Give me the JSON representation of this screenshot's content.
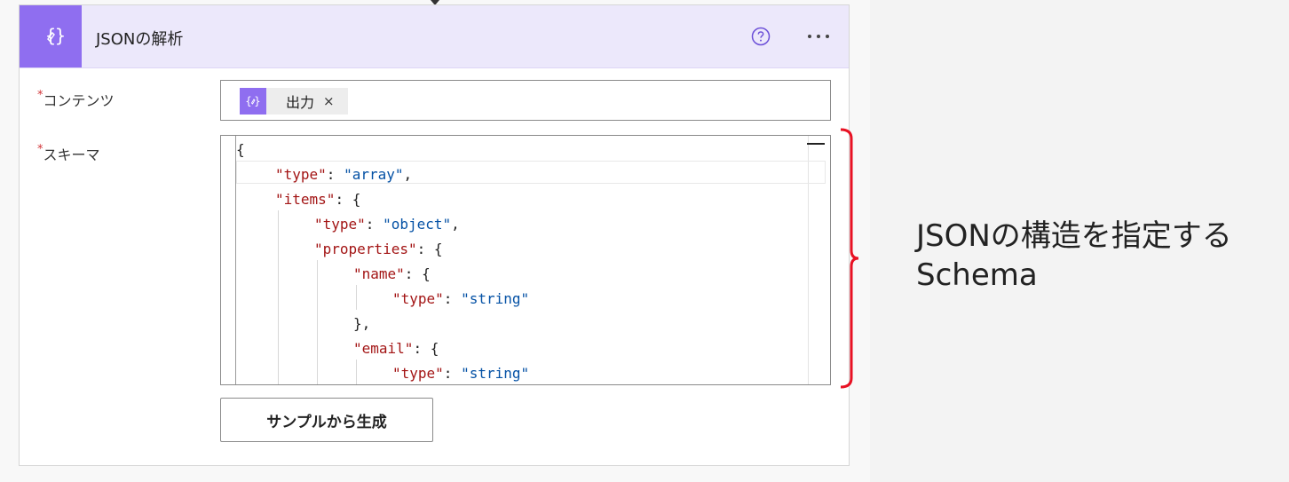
{
  "card": {
    "title": "JSONの解析",
    "help_icon": "help-circle-icon",
    "more_icon": "more-horizontal-icon",
    "action_icon": "curly-brace-expression-icon"
  },
  "fields": {
    "content": {
      "required_mark": "*",
      "label": "コンテンツ",
      "token": {
        "label": "出力",
        "close": "×",
        "icon": "curly-brace-expression-icon"
      }
    },
    "schema": {
      "required_mark": "*",
      "label": "スキーマ",
      "lines": [
        [
          {
            "t": "p",
            "v": "{"
          }
        ],
        [
          {
            "t": "k",
            "v": "\"type\""
          },
          {
            "t": "p",
            "v": ": "
          },
          {
            "t": "s",
            "v": "\"array\""
          },
          {
            "t": "p",
            "v": ","
          }
        ],
        [
          {
            "t": "k",
            "v": "\"items\""
          },
          {
            "t": "p",
            "v": ": {"
          }
        ],
        [
          {
            "t": "k",
            "v": "\"type\""
          },
          {
            "t": "p",
            "v": ": "
          },
          {
            "t": "s",
            "v": "\"object\""
          },
          {
            "t": "p",
            "v": ","
          }
        ],
        [
          {
            "t": "k",
            "v": "\"properties\""
          },
          {
            "t": "p",
            "v": ": {"
          }
        ],
        [
          {
            "t": "k",
            "v": "\"name\""
          },
          {
            "t": "p",
            "v": ": {"
          }
        ],
        [
          {
            "t": "k",
            "v": "\"type\""
          },
          {
            "t": "p",
            "v": ": "
          },
          {
            "t": "s",
            "v": "\"string\""
          }
        ],
        [
          {
            "t": "p",
            "v": "},"
          }
        ],
        [
          {
            "t": "k",
            "v": "\"email\""
          },
          {
            "t": "p",
            "v": ": {"
          }
        ],
        [
          {
            "t": "k",
            "v": "\"type\""
          },
          {
            "t": "p",
            "v": ": "
          },
          {
            "t": "s",
            "v": "\"string\""
          }
        ]
      ]
    }
  },
  "generate_button": {
    "label": "サンプルから生成"
  },
  "annotation": {
    "line1": "JSONの構造を指定する",
    "line2": "Schema"
  },
  "colors": {
    "accent": "#8f6ef0",
    "header_bg": "#ece8fb",
    "required": "#d13438",
    "json_key": "#a31515",
    "json_string": "#0451a5",
    "bracket": "#e81123"
  }
}
